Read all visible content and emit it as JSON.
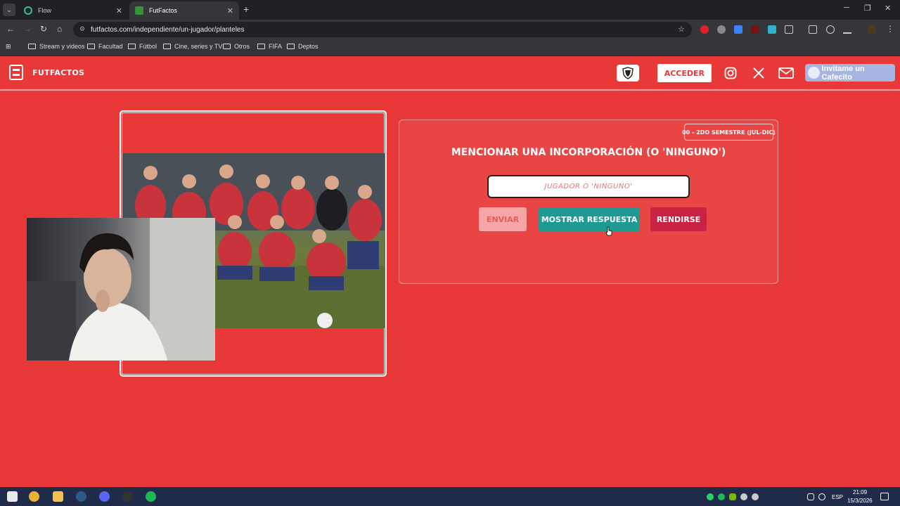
{
  "browser": {
    "tabs": [
      {
        "label": "Flow",
        "favicon_color": "#34c38f"
      },
      {
        "label": "FutFactos",
        "favicon_color": "#3a8f3a"
      }
    ],
    "new_tab": "+",
    "url": "futfactos.com/independiente/un-jugador/planteles",
    "bookmarks": [
      "Stream y videos",
      "Facultad",
      "Fútbol",
      "Cine, series y TV",
      "Otros",
      "FIFA",
      "Deptos"
    ]
  },
  "site": {
    "brand": "FUTFACTOS",
    "login_label": "ACCEDER",
    "cafecito_label": "Invitame un Cafecito",
    "icons": [
      "shield-icon",
      "instagram-icon",
      "x-icon",
      "mail-icon"
    ],
    "colors": {
      "background": "#e83838",
      "teal": "#1f9a93",
      "crimson": "#c92244"
    }
  },
  "question": {
    "badge": "00 - 2DO SEMESTRE (JUL-DIC)",
    "title": "MENCIONAR UNA INCORPORACIÓN (O 'NINGUNO')",
    "input_placeholder": "JUGADOR O 'NINGUNO'",
    "input_value": "",
    "send_label": "ENVIAR",
    "show_answer_label": "MOSTRAR RESPUESTA",
    "give_up_label": "RENDIRSE"
  },
  "taskbar": {
    "language": "ESP",
    "time": "21:09",
    "date": "15/3/2026"
  }
}
